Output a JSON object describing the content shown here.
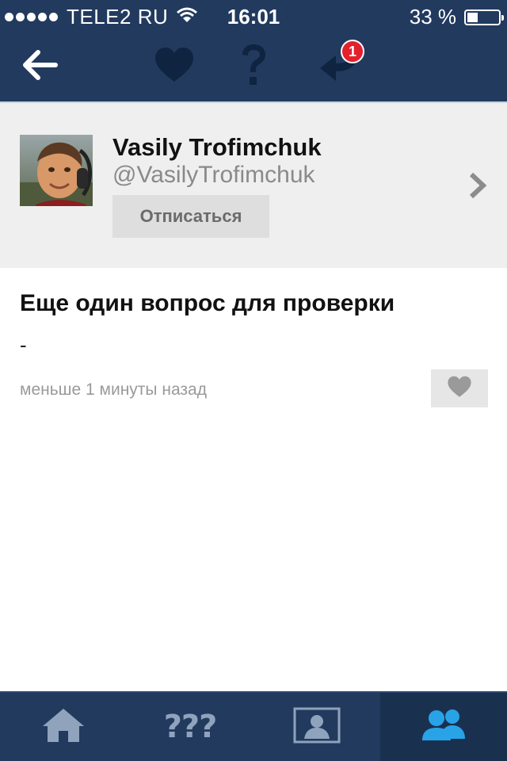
{
  "status_bar": {
    "carrier": "TELE2 RU",
    "time": "16:01",
    "battery_text": "33 %",
    "battery_level": 0.33,
    "signal_dots": 5,
    "wifi_icon": "wifi-icon"
  },
  "nav_bar": {
    "back_icon": "arrow-left-icon",
    "favorites_icon": "heart-icon",
    "questions_icon": "question-mark-icon",
    "replies_icon": "reply-arrow-icon",
    "replies_badge": "1",
    "badge_color": "#e3202b"
  },
  "profile": {
    "name": "Vasily Trofimchuk",
    "handle": "@VasilyTrofimchuk",
    "unfollow_label": "Отписаться",
    "chevron_icon": "chevron-right-icon"
  },
  "question": {
    "title": "Еще один вопрос для проверки",
    "body": "-",
    "time": "меньше 1 минуты назад",
    "like_icon": "heart-icon"
  },
  "tab_bar": {
    "tabs": [
      {
        "icon": "home-icon",
        "text": ""
      },
      {
        "icon": "questions-icon",
        "text": "???"
      },
      {
        "icon": "profile-card-icon",
        "text": ""
      },
      {
        "icon": "people-icon",
        "text": "",
        "active": true
      }
    ],
    "active_color": "#29a3e8",
    "inactive_color": "#8fa3bd"
  },
  "colors": {
    "navy": "#223a5e",
    "profile_bg": "#efefef"
  }
}
